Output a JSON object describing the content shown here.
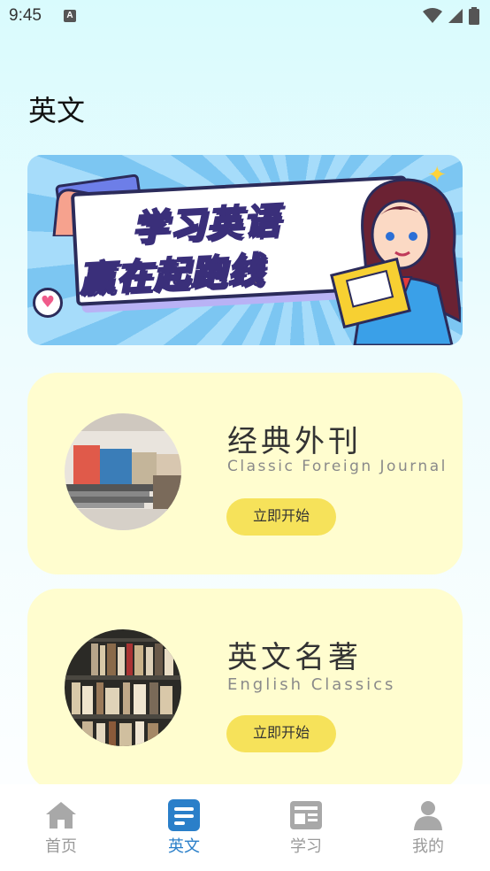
{
  "status_bar": {
    "time": "9:45",
    "notification_letter": "A"
  },
  "page": {
    "title": "英文"
  },
  "banner": {
    "line1": "学习英语",
    "line2": "赢在起跑线"
  },
  "cards": [
    {
      "title": "经典外刊",
      "subtitle": "Classic Foreign Journal",
      "button_label": "立即开始"
    },
    {
      "title": "英文名著",
      "subtitle": "English Classics",
      "button_label": "立即开始"
    }
  ],
  "bottom_nav": {
    "items": [
      {
        "label": "首页",
        "icon": "home-icon",
        "active": false
      },
      {
        "label": "英文",
        "icon": "document-icon",
        "active": true
      },
      {
        "label": "学习",
        "icon": "newspaper-icon",
        "active": false
      },
      {
        "label": "我的",
        "icon": "person-icon",
        "active": false
      }
    ]
  },
  "colors": {
    "accent": "#2a7fc9",
    "card_bg": "#fffdcf",
    "button_bg": "#f6e25a",
    "nav_inactive": "#9a9a9a"
  }
}
